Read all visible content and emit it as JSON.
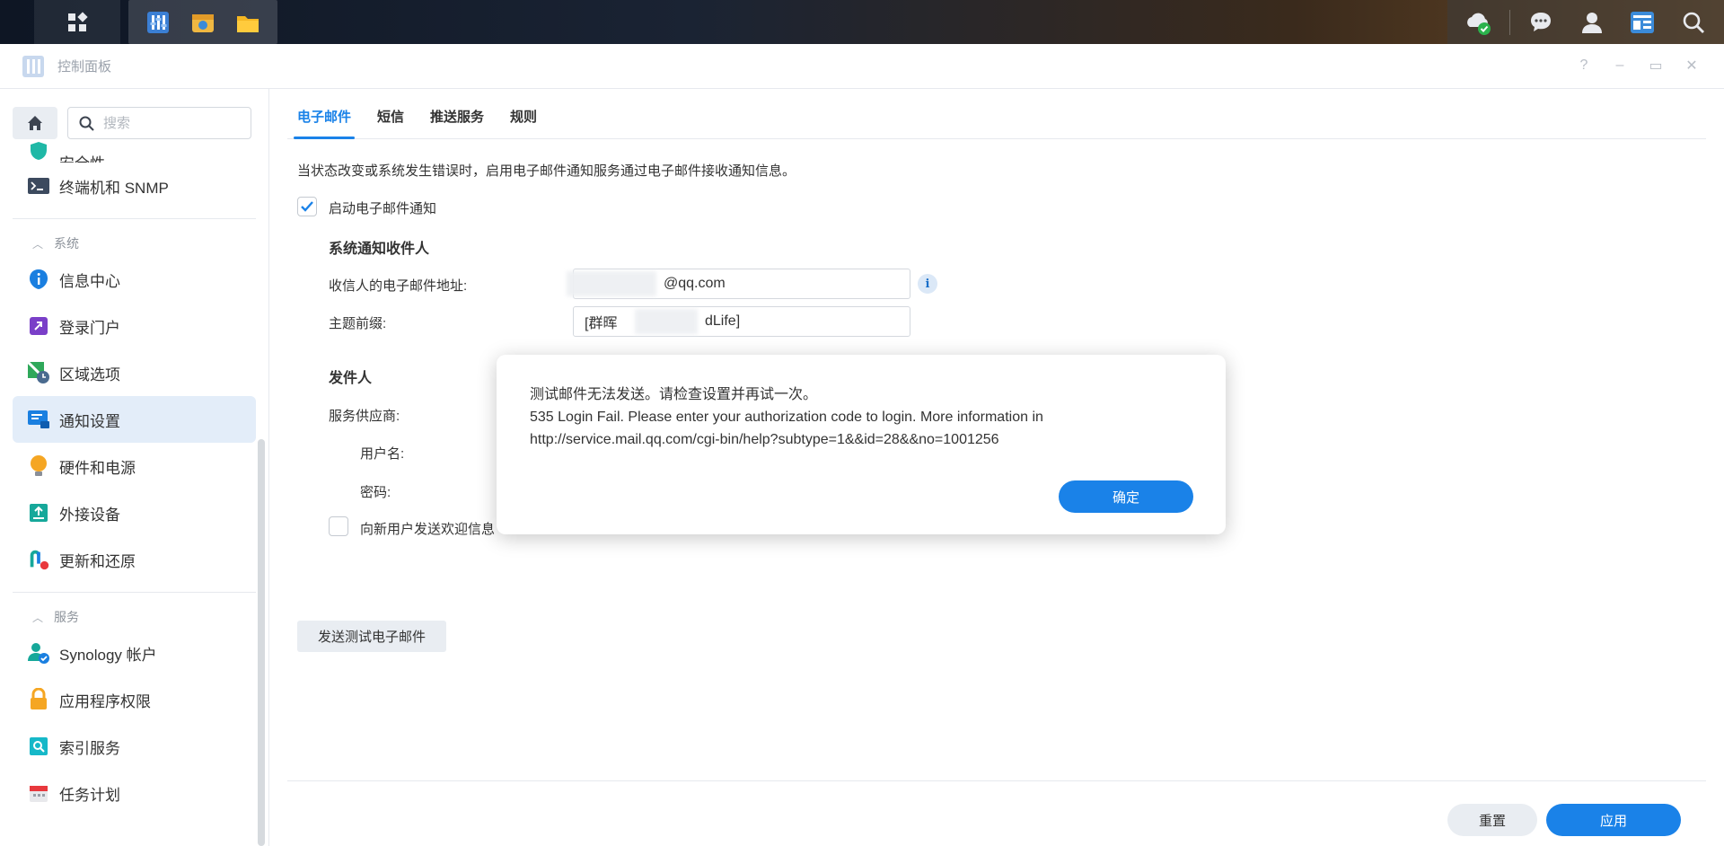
{
  "taskbar": {
    "main_menu_icon": "grid-icon",
    "apps": [
      "control-panel-icon",
      "package-center-icon",
      "file-station-icon"
    ],
    "tray": [
      "cloud-sync-icon",
      "chat-icon",
      "user-icon",
      "widgets-icon",
      "search-icon"
    ]
  },
  "window": {
    "title": "控制面板",
    "controls": [
      "?",
      "–",
      "▭",
      "✕"
    ]
  },
  "sidebar": {
    "search_placeholder": "搜索",
    "partial_item": "安全性",
    "items_top": [
      {
        "label": "终端机和 SNMP",
        "icon": "terminal-icon"
      }
    ],
    "group_system": "系统",
    "items_system": [
      {
        "label": "信息中心",
        "icon": "info-icon"
      },
      {
        "label": "登录门户",
        "icon": "login-portal-icon"
      },
      {
        "label": "区域选项",
        "icon": "regional-icon"
      },
      {
        "label": "通知设置",
        "icon": "notification-icon",
        "active": true
      },
      {
        "label": "硬件和电源",
        "icon": "hardware-power-icon"
      },
      {
        "label": "外接设备",
        "icon": "external-device-icon"
      },
      {
        "label": "更新和还原",
        "icon": "update-restore-icon"
      }
    ],
    "group_services": "服务",
    "items_services": [
      {
        "label": "Synology 帐户",
        "icon": "synology-account-icon"
      },
      {
        "label": "应用程序权限",
        "icon": "app-privileges-icon"
      },
      {
        "label": "索引服务",
        "icon": "indexing-icon"
      },
      {
        "label": "任务计划",
        "icon": "task-scheduler-icon"
      }
    ]
  },
  "main": {
    "tabs": [
      {
        "label": "电子邮件",
        "active": true
      },
      {
        "label": "短信"
      },
      {
        "label": "推送服务"
      },
      {
        "label": "规则"
      }
    ],
    "description": "当状态改变或系统发生错误时，启用电子邮件通知服务通过电子邮件接收通知信息。",
    "enable_email_label": "启动电子邮件通知",
    "enable_email_checked": true,
    "section_recipients": "系统通知收件人",
    "recipient_email_label": "收信人的电子邮件地址:",
    "recipient_email_value": "@qq.com",
    "subject_prefix_label": "主题前缀:",
    "subject_prefix_value_left": "[群晖",
    "subject_prefix_value_right": "dLife]",
    "section_sender": "发件人",
    "provider_label": "服务供应商:",
    "username_label": "用户名:",
    "password_label": "密码:",
    "welcome_label": "向新用户发送欢迎信息",
    "welcome_checked": false,
    "send_test_label": "发送测试电子邮件",
    "reset_label": "重置",
    "apply_label": "应用"
  },
  "dialog": {
    "line1": "测试邮件无法发送。请检查设置并再试一次。",
    "line2": "535 Login Fail. Please enter your authorization code to login. More information in",
    "line3": "http://service.mail.qq.com/cgi-bin/help?subtype=1&&id=28&&no=1001256",
    "ok_label": "确定"
  },
  "colors": {
    "accent": "#1a82e8",
    "active_nav_bg": "#e3edf9",
    "button_grey": "#e9edf2"
  }
}
